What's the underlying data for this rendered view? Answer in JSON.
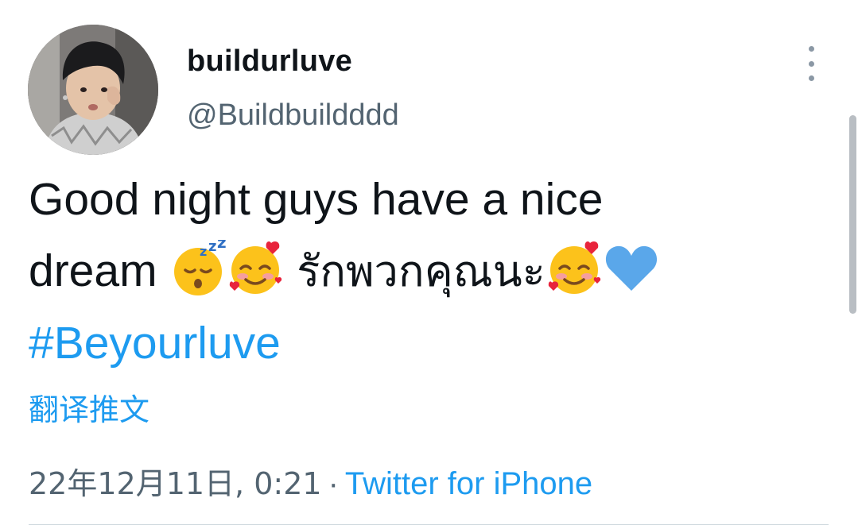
{
  "user": {
    "display_name": "buildurluve",
    "handle": "@Buildbuildddd"
  },
  "tweet": {
    "line1": "Good night guys have a nice",
    "line2_prefix": "dream ",
    "thai_text": "รักพวกคุณนะ",
    "hashtag": "#Beyourluve",
    "emojis": [
      "sleeping-face-emoji",
      "smiling-face-with-hearts-emoji",
      "smiling-face-with-hearts-emoji",
      "blue-heart-emoji"
    ]
  },
  "translate_label": "翻译推文",
  "meta": {
    "date": "22年12月11日, 0:21",
    "separator": "·",
    "source": "Twitter for iPhone"
  },
  "colors": {
    "link": "#1d9bf0",
    "secondary_text": "#536471",
    "primary_text": "#0f1419",
    "heart_blue": "#5aa7ea"
  }
}
